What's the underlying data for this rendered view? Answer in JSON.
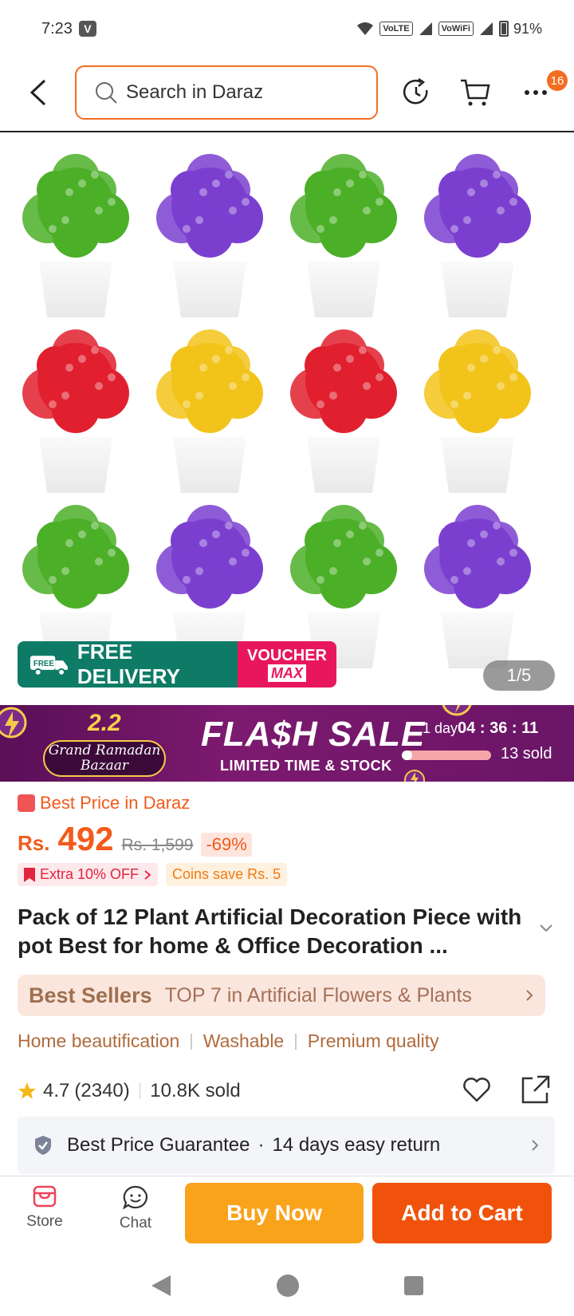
{
  "status_bar": {
    "time": "7:23",
    "carrier_badge": "V",
    "volte": "VoLTE",
    "vowifi": "VoWiFi",
    "battery": "91%"
  },
  "header": {
    "search_placeholder": "Search in Daraz",
    "cart_badge_count": "16"
  },
  "gallery": {
    "free_delivery": "FREE DELIVERY",
    "free_tag": "FREE",
    "voucher": "VOUCHER",
    "voucher_max": "MAX",
    "counter": "1/5",
    "plant_colors": [
      "#4caf28",
      "#7b3fd0",
      "#4caf28",
      "#7b3fd0",
      "#e0202e",
      "#f2c31a",
      "#e0202e",
      "#f2c31a",
      "#4caf28",
      "#7b3fd0",
      "#4caf28",
      "#7b3fd0"
    ]
  },
  "flash_sale": {
    "campaign_number": "2.2",
    "campaign_line1": "Grand Ramadan",
    "campaign_line2": "Bazaar",
    "title": "FLA$H SALE",
    "subtitle": "LIMITED TIME & STOCK",
    "timer_day": "1 day",
    "timer_clock": "04 : 36 : 11",
    "sold": "13 sold",
    "progress_fraction": 0.12
  },
  "price": {
    "best_price_label": "Best Price in Daraz",
    "currency": "Rs.",
    "amount": "492",
    "original": "Rs. 1,599",
    "discount": "-69%",
    "extra_off": "Extra 10% OFF",
    "coins": "Coins save Rs. 5"
  },
  "product": {
    "title": "Pack of 12 Plant Artificial Decoration Piece with pot Best for home & Office Decoration ...",
    "best_sellers_brand": "Best Sellers",
    "best_sellers_text": "TOP 7 in Artificial Flowers & Plants",
    "features": [
      "Home beautification",
      "Washable",
      "Premium quality"
    ],
    "rating": "4.7",
    "reviews": "(2340)",
    "sold": "10.8K sold"
  },
  "guarantee": {
    "left": "Best Price Guarantee",
    "dot": "·",
    "right": "14 days easy return"
  },
  "bottom_bar": {
    "store": "Store",
    "chat": "Chat",
    "buy_now": "Buy Now",
    "add_to_cart": "Add to Cart"
  },
  "colors": {
    "accent": "#f36d21",
    "buy_now": "#f9a31b",
    "add_to_cart": "#f1520b",
    "flash_bg": "#6a1566"
  }
}
